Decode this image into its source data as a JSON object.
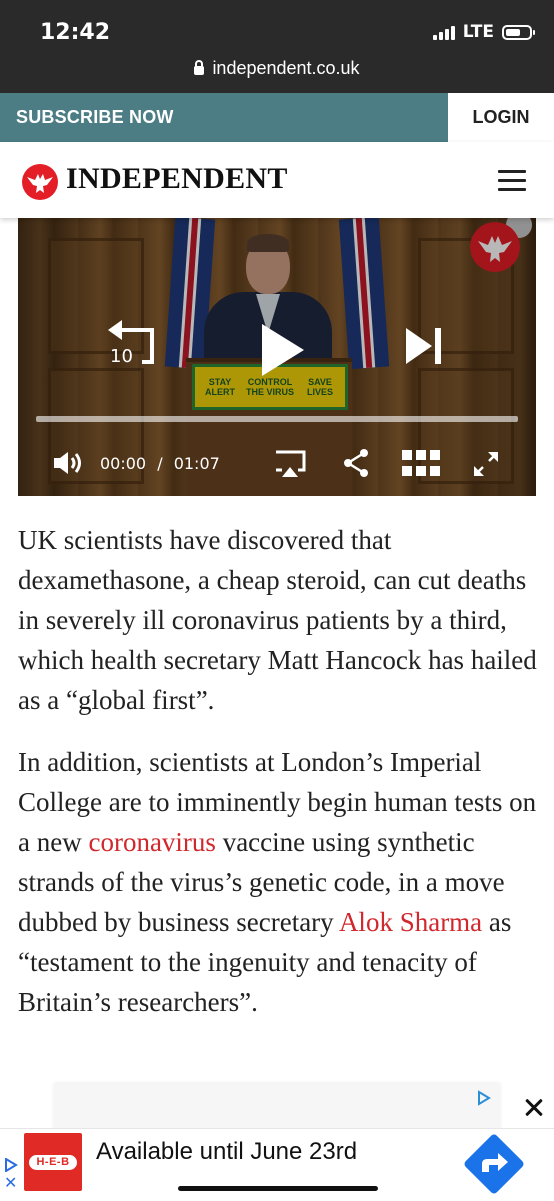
{
  "status_bar": {
    "time": "12:42",
    "network": "LTE",
    "url": "independent.co.uk"
  },
  "subscribe_bar": {
    "subscribe_label": "SUBSCRIBE NOW",
    "login_label": "LOGIN"
  },
  "masthead": {
    "logo_text": "INDEPENDENT",
    "menu_icon": "hamburger-menu-icon"
  },
  "video": {
    "sign_panels": [
      "STAY\nALERT",
      "CONTROL\nTHE VIRUS",
      "SAVE\nLIVES"
    ],
    "replay_label": "10",
    "current_time": "00:00",
    "separator": "/",
    "duration": "01:07",
    "progress_fraction": 0,
    "icons": [
      "replay-10-icon",
      "play-icon",
      "skip-next-icon",
      "volume-icon",
      "airplay-icon",
      "share-icon",
      "grid-icon",
      "fullscreen-icon"
    ]
  },
  "article": {
    "p1": "UK scientists have discovered that dexamethasone, a cheap steroid, can cut deaths in severely ill coronavirus patients by a third, which health secretary Matt Hancock has hailed as a “global first”.",
    "p2_part1": "In addition, scientists at London’s Imperial College are to imminently begin human tests on a new ",
    "p2_link1": "coronavirus",
    "p2_part2": " vaccine using synthetic strands of the virus’s genetic code, in a move dubbed by business secretary ",
    "p2_link2": "Alok Sharma",
    "p2_part3": " as “testament to the ingenuity and tenacity of Britain’s researchers”."
  },
  "ad": {
    "brand_badge": "H-E-B",
    "headline": "Available until June 23rd",
    "close_icon": "close-icon",
    "cta_icon": "directions-arrow-icon"
  },
  "colors": {
    "status_bar": "#2a2a2a",
    "subscribe_bg": "#4c7c84",
    "link": "#d0282c",
    "brand_red": "#e41e26",
    "heb_red": "#e02a26",
    "cta_blue": "#1a73e8"
  }
}
